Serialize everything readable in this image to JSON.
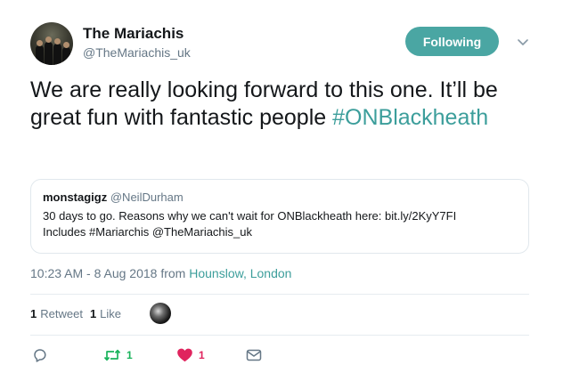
{
  "author": {
    "display_name": "The Mariachis",
    "handle": "@TheMariachis_uk"
  },
  "follow_button": {
    "label": "Following"
  },
  "tweet": {
    "text_part1": "We are really looking forward to this one. It’ll be great fun with fantastic people",
    "hashtag": "#ONBlackheath"
  },
  "quoted_tweet": {
    "name": "monstagigz",
    "handle": "@NeilDurham",
    "line1": "30 days to go. Reasons why we can't wait for ONBlackheath here: bit.ly/2KyY7FI",
    "line2": "Includes #Mariarchis @TheMariachis_uk"
  },
  "meta": {
    "timestamp": "10:23 AM - 8 Aug 2018 from",
    "location": "Hounslow, London"
  },
  "stats": {
    "retweet_count": "1",
    "retweet_label": "Retweet",
    "like_count": "1",
    "like_label": "Like"
  },
  "actions": {
    "retweet_count": "1",
    "like_count": "1"
  },
  "colors": {
    "accent": "#4aa6a3",
    "hashtag": "#3c9e9b",
    "retweet": "#19b35b",
    "like": "#e0245e",
    "muted": "#657786"
  },
  "icons": [
    "reply-icon",
    "retweet-icon",
    "heart-icon",
    "message-icon",
    "chevron-down-icon"
  ]
}
